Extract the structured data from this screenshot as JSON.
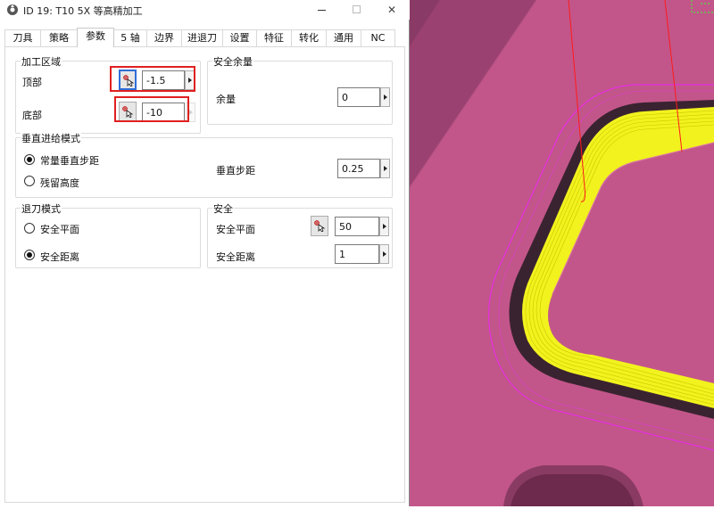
{
  "window": {
    "title": "ID 19: T10 5X 等高精加工",
    "minimize_label": "",
    "close_label": "✕"
  },
  "tabs": [
    {
      "label": "刀具"
    },
    {
      "label": "策略"
    },
    {
      "label": "参数"
    },
    {
      "label": "5 轴"
    },
    {
      "label": "边界"
    },
    {
      "label": "进退刀"
    },
    {
      "label": "设置"
    },
    {
      "label": "特征"
    },
    {
      "label": "转化"
    },
    {
      "label": "通用"
    },
    {
      "label": "NC"
    }
  ],
  "active_tab": "参数",
  "machining_area": {
    "legend": "加工区域",
    "top_label": "顶部",
    "top_value": "-1.5",
    "bottom_label": "底部",
    "bottom_value": "-10"
  },
  "safety_allowance": {
    "legend": "安全余量",
    "allowance_label": "余量",
    "allowance_value": "0"
  },
  "vertical_feed": {
    "legend": "垂直进给模式",
    "option_constant": "常量垂直步距",
    "option_scallop": "残留高度",
    "selected": "常量垂直步距",
    "step_label": "垂直步距",
    "step_value": "0.25"
  },
  "retract": {
    "legend": "退刀模式",
    "option_plane": "安全平面",
    "option_distance": "安全距离",
    "selected": "安全距离"
  },
  "safety": {
    "legend": "安全",
    "plane_label": "安全平面",
    "plane_value": "50",
    "distance_label": "安全距离",
    "distance_value": "1"
  },
  "colors": {
    "part_surface": "#c2568a",
    "part_dark": "#8a3b63",
    "toolpath": "#ffff00",
    "boundary": "#e52ee0",
    "tool_axis": "#ff1a1a",
    "highlight_box": "#e02020",
    "focus_blue": "#2f6ed8"
  }
}
